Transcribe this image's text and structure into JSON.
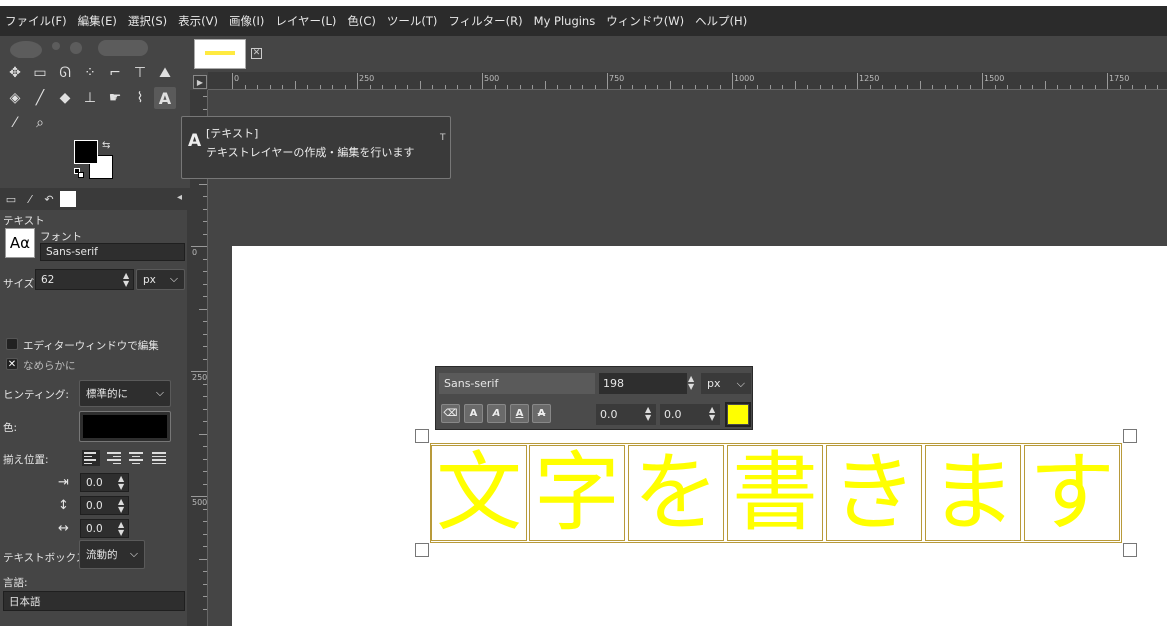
{
  "menu": [
    "ファイル(F)",
    "編集(E)",
    "選択(S)",
    "表示(V)",
    "画像(I)",
    "レイヤー(L)",
    "色(C)",
    "ツール(T)",
    "フィルター(R)",
    "My Plugins",
    "ウィンドウ(W)",
    "ヘルプ(H)"
  ],
  "tooltip": {
    "title": "[テキスト]",
    "desc": "テキストレイヤーの作成・編集を行います",
    "extra": "T"
  },
  "options": {
    "section_title": "テキスト",
    "font_label": "フォント",
    "font_preview": "Aα",
    "font_value": "Sans-serif",
    "size_label": "サイズ:",
    "size_value": "62",
    "size_unit": "px",
    "editor_label": "エディターウィンドウで編集",
    "antialias_label": "なめらかに",
    "hinting_label": "ヒンティング:",
    "hinting_value": "標準的に",
    "color_label": "色:",
    "color_value": "#000000",
    "justify_label": "揃え位置:",
    "indent_value": "0.0",
    "line_spacing_value": "0.0",
    "letter_spacing_value": "0.0",
    "textbox_label": "テキストボックス:",
    "textbox_value": "流動的",
    "language_label": "言語:",
    "language_value": "日本語"
  },
  "ruler": {
    "h_labels": [
      "0",
      "250",
      "500",
      "750",
      "1000",
      "1250",
      "1500",
      "1750"
    ],
    "v_labels": [
      "0",
      "250",
      "500"
    ]
  },
  "osd": {
    "font": "Sans-serif",
    "size": "198",
    "unit": "px",
    "baseline": "0.0",
    "kerning": "0.0",
    "text_color": "#ffff00"
  },
  "canvas_text": [
    "文",
    "字",
    "を",
    "書",
    "き",
    "ま",
    "す"
  ]
}
